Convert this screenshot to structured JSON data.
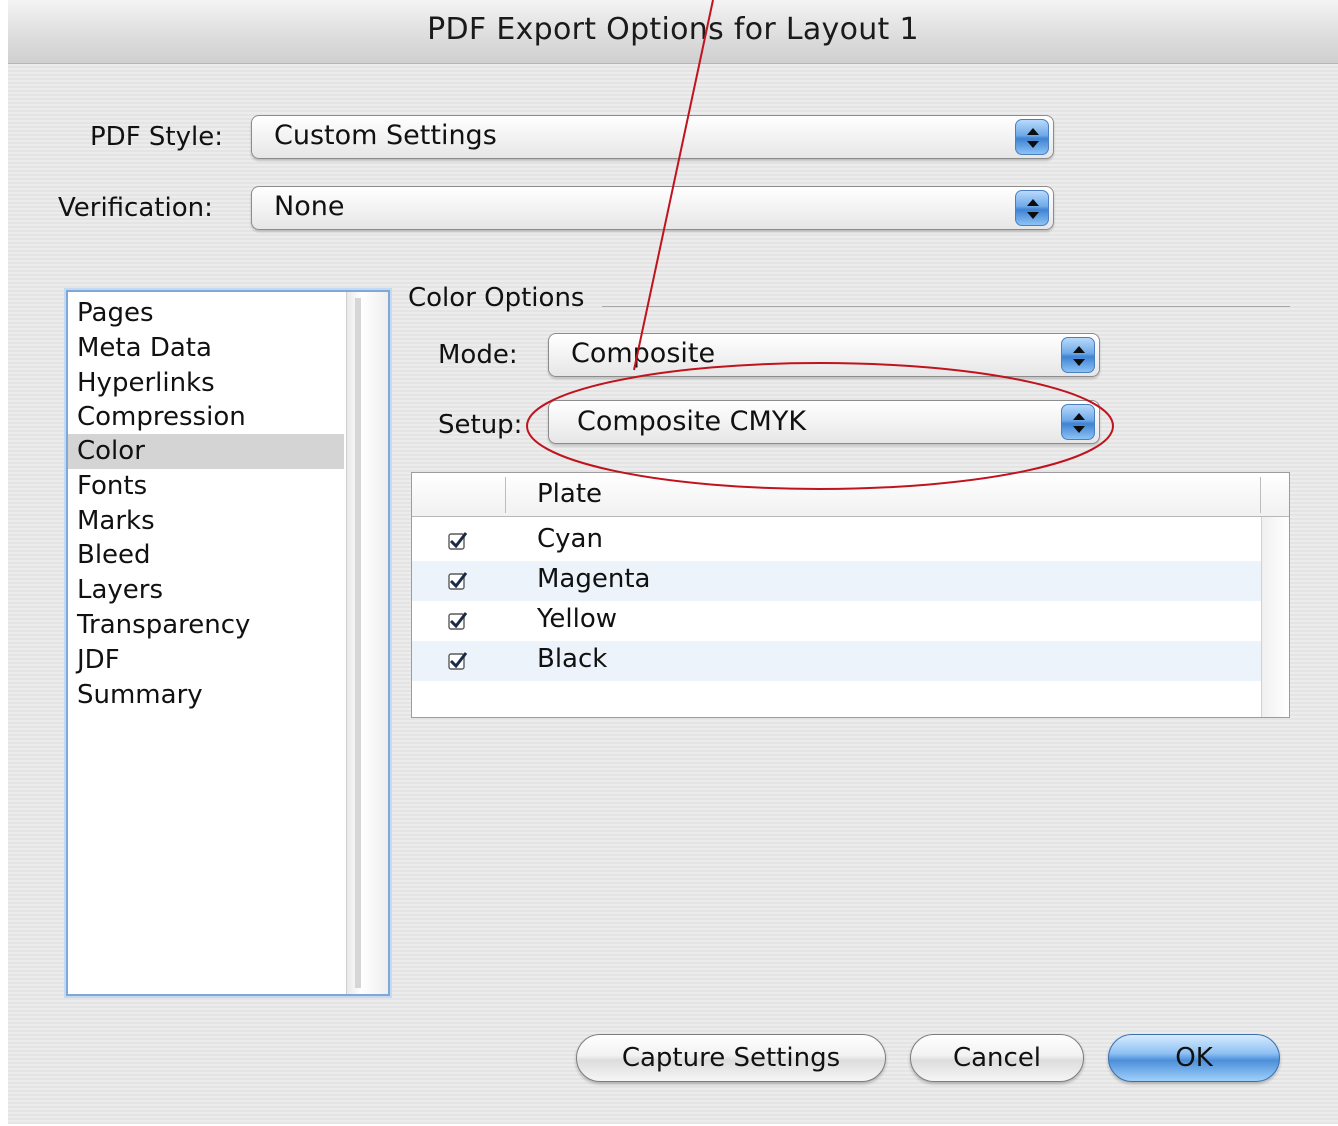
{
  "window": {
    "title": "PDF Export Options for Layout 1"
  },
  "pdf_style": {
    "label": "PDF Style:",
    "value": "Custom Settings"
  },
  "verification": {
    "label": "Verification:",
    "value": "None"
  },
  "sidebar": {
    "items": [
      {
        "label": "Pages"
      },
      {
        "label": "Meta Data"
      },
      {
        "label": "Hyperlinks"
      },
      {
        "label": "Compression"
      },
      {
        "label": "Color",
        "selected": true
      },
      {
        "label": "Fonts"
      },
      {
        "label": "Marks"
      },
      {
        "label": "Bleed"
      },
      {
        "label": "Layers"
      },
      {
        "label": "Transparency"
      },
      {
        "label": "JDF"
      },
      {
        "label": "Summary"
      }
    ]
  },
  "color_options": {
    "group_label": "Color Options",
    "mode": {
      "label": "Mode:",
      "value": "Composite"
    },
    "setup": {
      "label": "Setup:",
      "value": "Composite CMYK"
    }
  },
  "plates": {
    "header": "Plate",
    "rows": [
      {
        "name": "Cyan",
        "checked": true
      },
      {
        "name": "Magenta",
        "checked": true
      },
      {
        "name": "Yellow",
        "checked": true
      },
      {
        "name": "Black",
        "checked": true
      }
    ]
  },
  "buttons": {
    "capture": "Capture Settings",
    "cancel": "Cancel",
    "ok": "OK"
  },
  "colors": {
    "annotation": "#c0131d",
    "selection": "#d4d4d4",
    "accent_blue": "#4c8fd9"
  },
  "icons": {
    "popup_arrows": "up-down-arrows-icon",
    "checkbox": "checkmark-icon"
  }
}
